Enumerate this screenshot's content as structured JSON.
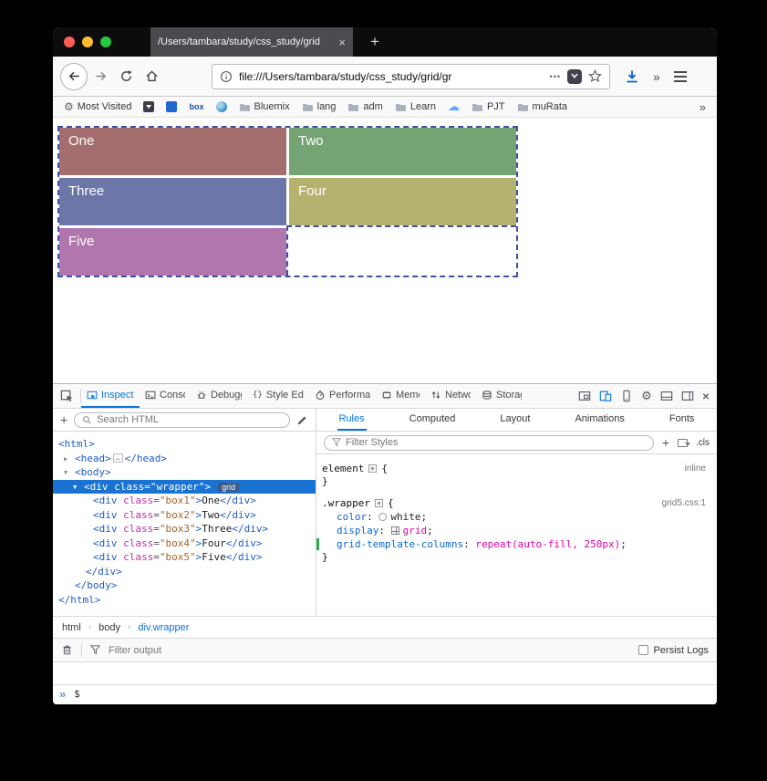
{
  "window": {
    "tab_title": "/Users/tambara/study/css_study/grid",
    "tab_close": "×",
    "new_tab_button": "+"
  },
  "nav": {
    "url": "file:///Users/tambara/study/css_study/grid/gr",
    "page_actions": "•••",
    "overflow_chevron": "»"
  },
  "bookmarks": {
    "most_visited_label": "Most Visited",
    "box_favicon_label": "box",
    "folders": [
      "Bluemix",
      "lang",
      "adm",
      "Learn",
      "PJT",
      "muRata"
    ],
    "overflow_chevron": "»"
  },
  "page": {
    "grid_border_color": "#3f51a3",
    "boxes": [
      {
        "label": "One",
        "color": "#a56e6e"
      },
      {
        "label": "Two",
        "color": "#74a374"
      },
      {
        "label": "Three",
        "color": "#6d76a8"
      },
      {
        "label": "Four",
        "color": "#b5b16f"
      },
      {
        "label": "Five",
        "color": "#b276ae"
      }
    ]
  },
  "devtools": {
    "tabs": [
      {
        "label": "Inspector",
        "active": true
      },
      {
        "label": "Console",
        "active": false
      },
      {
        "label": "Debugger",
        "active": false
      },
      {
        "label": "Style Editor",
        "active": false
      },
      {
        "label": "Performance",
        "active": false
      },
      {
        "label": "Memory",
        "active": false
      },
      {
        "label": "Network",
        "active": false
      },
      {
        "label": "Storage",
        "active": false
      }
    ],
    "markup": {
      "add_node_button": "+",
      "search_placeholder": "Search HTML",
      "lines": [
        {
          "pad": 6,
          "twisty": null,
          "tokens": [
            [
              "tag",
              "<html>"
            ]
          ]
        },
        {
          "pad": 24,
          "twisty": "closed",
          "tokens": [
            [
              "tag",
              "<head>"
            ],
            [
              "ellipsis",
              "…"
            ],
            [
              "tag",
              "</head>"
            ]
          ]
        },
        {
          "pad": 24,
          "twisty": "open",
          "tokens": [
            [
              "tag",
              "<body>"
            ]
          ]
        },
        {
          "pad": 34,
          "twisty": "open",
          "selected": true,
          "badge": "grid",
          "tokens": [
            [
              "tag",
              "<div"
            ],
            [
              "text",
              " "
            ],
            [
              "attr",
              "class"
            ],
            [
              "punct",
              "="
            ],
            [
              "val",
              "\"wrapper\""
            ],
            [
              "tag",
              ">"
            ]
          ]
        },
        {
          "pad": 44,
          "twisty": null,
          "tokens": [
            [
              "tag",
              "<div"
            ],
            [
              "text",
              " "
            ],
            [
              "attr",
              "class"
            ],
            [
              "punct",
              "="
            ],
            [
              "val",
              "\"box1\""
            ],
            [
              "tag",
              ">"
            ],
            [
              "text",
              "One"
            ],
            [
              "tag",
              "</div>"
            ]
          ]
        },
        {
          "pad": 44,
          "twisty": null,
          "tokens": [
            [
              "tag",
              "<div"
            ],
            [
              "text",
              " "
            ],
            [
              "attr",
              "class"
            ],
            [
              "punct",
              "="
            ],
            [
              "val",
              "\"box2\""
            ],
            [
              "tag",
              ">"
            ],
            [
              "text",
              "Two"
            ],
            [
              "tag",
              "</div>"
            ]
          ]
        },
        {
          "pad": 44,
          "twisty": null,
          "tokens": [
            [
              "tag",
              "<div"
            ],
            [
              "text",
              " "
            ],
            [
              "attr",
              "class"
            ],
            [
              "punct",
              "="
            ],
            [
              "val",
              "\"box3\""
            ],
            [
              "tag",
              ">"
            ],
            [
              "text",
              "Three"
            ],
            [
              "tag",
              "</div>"
            ]
          ]
        },
        {
          "pad": 44,
          "twisty": null,
          "tokens": [
            [
              "tag",
              "<div"
            ],
            [
              "text",
              " "
            ],
            [
              "attr",
              "class"
            ],
            [
              "punct",
              "="
            ],
            [
              "val",
              "\"box4\""
            ],
            [
              "tag",
              ">"
            ],
            [
              "text",
              "Four"
            ],
            [
              "tag",
              "</div>"
            ]
          ]
        },
        {
          "pad": 44,
          "twisty": null,
          "tokens": [
            [
              "tag",
              "<div"
            ],
            [
              "text",
              " "
            ],
            [
              "attr",
              "class"
            ],
            [
              "punct",
              "="
            ],
            [
              "val",
              "\"box5\""
            ],
            [
              "tag",
              ">"
            ],
            [
              "text",
              "Five"
            ],
            [
              "tag",
              "</div>"
            ]
          ]
        },
        {
          "pad": 36,
          "twisty": null,
          "tokens": [
            [
              "tag",
              "</div>"
            ]
          ]
        },
        {
          "pad": 24,
          "twisty": null,
          "tokens": [
            [
              "tag",
              "</body>"
            ]
          ]
        },
        {
          "pad": 6,
          "twisty": null,
          "tokens": [
            [
              "tag",
              "</html>"
            ]
          ]
        }
      ]
    },
    "breadcrumbs": {
      "items": [
        "html",
        "body",
        "div.wrapper"
      ],
      "separator": "›"
    },
    "rules": {
      "tabs": [
        "Rules",
        "Computed",
        "Layout",
        "Animations",
        "Fonts"
      ],
      "active_tab": "Rules",
      "filter_placeholder": "Filter Styles",
      "add_rule_button": "+",
      "class_toggle_label": ".cls",
      "blocks": [
        {
          "selector": "element",
          "source": "inline",
          "open_brace": "{",
          "close_brace": "}",
          "props": []
        },
        {
          "selector": ".wrapper",
          "source": "grid5.css:1",
          "open_brace": "{",
          "close_brace": "}",
          "props": [
            {
              "name": "color",
              "value": "white",
              "swatch": "color",
              "changed": false
            },
            {
              "name": "display",
              "value": "grid",
              "swatch": "grid",
              "changed": false
            },
            {
              "name": "grid-template-columns",
              "value": "repeat(auto-fill, 250px)",
              "swatch": null,
              "changed": true
            }
          ]
        }
      ]
    },
    "console": {
      "filter_placeholder": "Filter output",
      "persist_label": "Persist Logs",
      "prompt_chevron": "»",
      "input_text": "$"
    }
  }
}
